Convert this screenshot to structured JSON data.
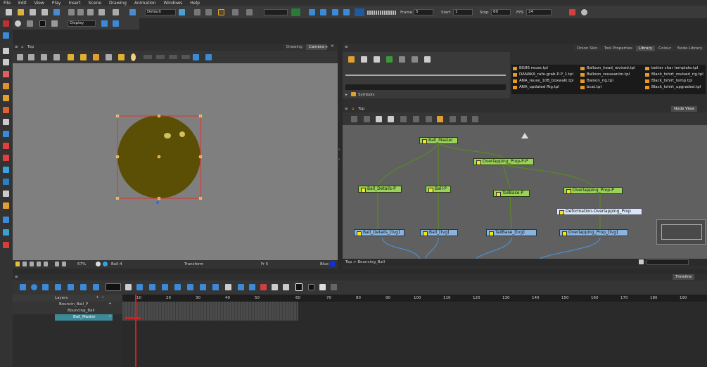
{
  "menu": [
    "File",
    "Edit",
    "View",
    "Play",
    "Insert",
    "Scene",
    "Drawing",
    "Animation",
    "Windows",
    "Help"
  ],
  "toolbar": {
    "workspace_value": "Default",
    "display_value": "Display",
    "frame_label": "Frame",
    "frame_value": "5",
    "start_label": "Start",
    "start_value": "1",
    "stop_label": "Stop",
    "stop_value": "60",
    "fps_label": "FPS",
    "fps_value": "24"
  },
  "camera_view": {
    "title": "Top",
    "tabs": [
      "Drawing",
      "Camera"
    ],
    "zoom": "67%",
    "layer": "Ball-4",
    "mode": "Transform",
    "frame": "Fr 5",
    "color_label": "Blue"
  },
  "library": {
    "tabs": [
      "Onion Skin",
      "Tool Properties",
      "Library",
      "Colour",
      "Node Library"
    ],
    "folder": "Symbols",
    "items": [
      "BG86 reuse.tpl",
      "DANAKA_rafe-grab-P-P_1.tpl",
      "ANA_reuse_10B_boxwalk.tpl",
      "ANA_updated Rig.tpl",
      "Balloon_head_revised.tpl",
      "Balloon_reuseanim.tpl",
      "Baloon_rig.tpl",
      "bcat.tpl",
      "better char template.tpl",
      "Black_tshirt_revised_rig.tpl",
      "Black_tshirt_temp.tpl",
      "Black_tshirt_upgraded.tpl"
    ]
  },
  "node_view": {
    "title": "Top",
    "tab": "Node View",
    "breadcrumb": "Top > Bouncing_Ball",
    "nodes": {
      "ball_master": "Ball_Master",
      "overlapping_pp": "Overlapping_Prop-P-P",
      "ball_details_p": "Ball_Details-P",
      "ball_p": "Ball-P",
      "tailbase_p": "TailBase-P",
      "overlapping_p": "Overlapping_Prop-P",
      "deformation": "Deformation-Overlapping_Prop",
      "ball_details_tvg": "Ball_Details_[tvg]",
      "ball_tvg": "Ball_[tvg]",
      "tailbase_tvg": "TailBase_[tvg]",
      "overlapping_tvg": "Overlapping_Prop_[tvg]"
    }
  },
  "timeline": {
    "tab": "Timeline",
    "layers_label": "Layers",
    "layers": [
      "Bouncin_Ball_P",
      "Bouncing_Ball",
      "Ball_Master"
    ],
    "ruler": [
      "10",
      "20",
      "30",
      "40",
      "50",
      "60",
      "70",
      "80",
      "90",
      "100",
      "110",
      "120",
      "130",
      "140",
      "150",
      "160",
      "170",
      "180",
      "190"
    ]
  },
  "colors": {
    "ball": "#5a4f04",
    "node_green": "#9bd25a",
    "node_blue": "#8ab4dd",
    "selection": "#e03030",
    "playhead": "#d02020"
  }
}
